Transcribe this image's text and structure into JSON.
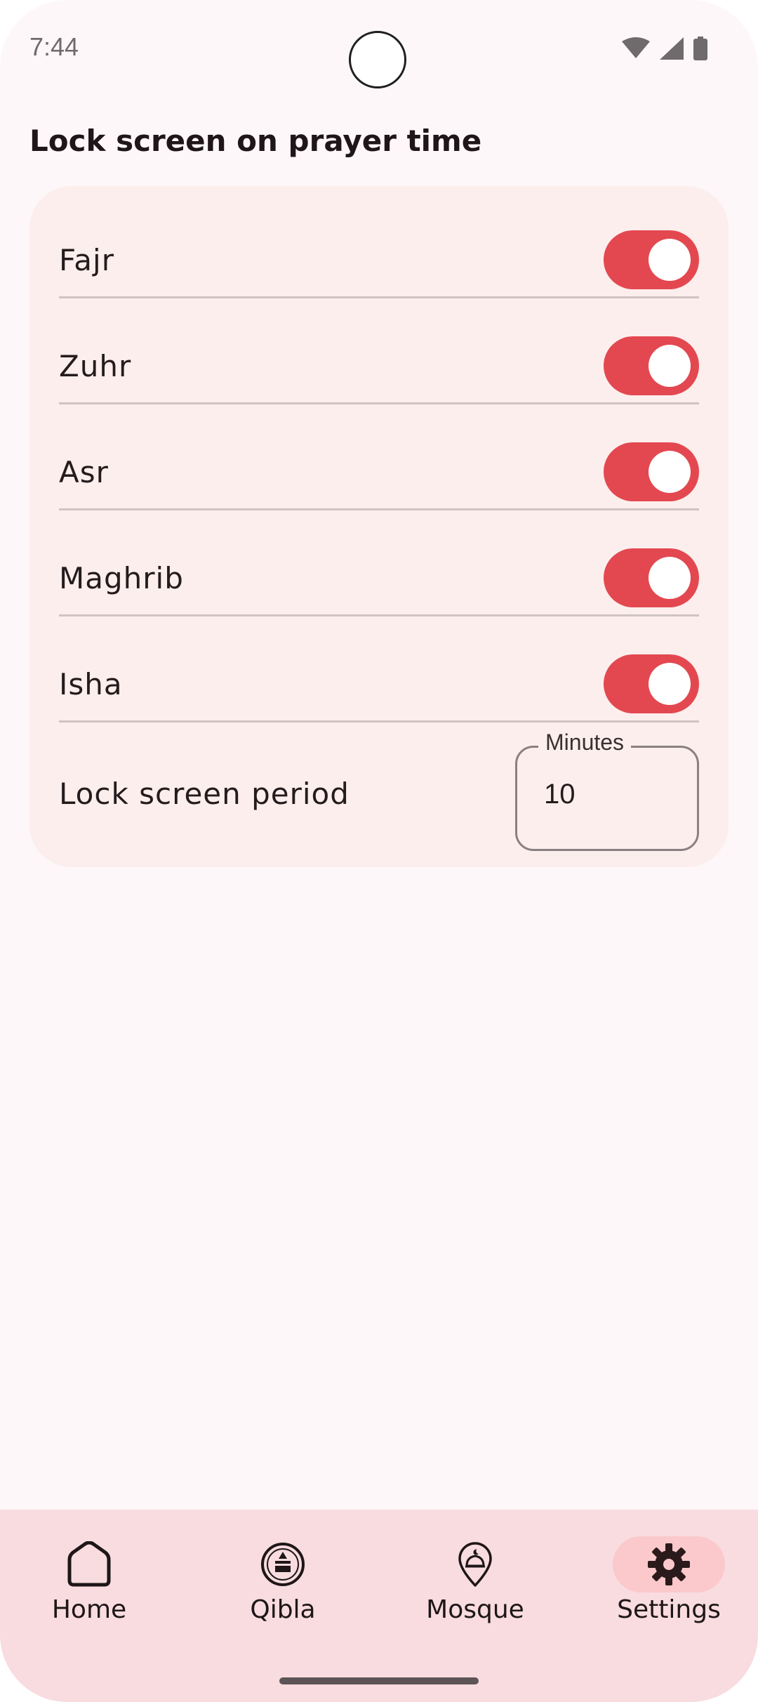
{
  "status_bar": {
    "time": "7:44"
  },
  "header": {
    "title": "Lock screen on prayer time"
  },
  "prayers": [
    {
      "label": "Fajr",
      "enabled": true
    },
    {
      "label": "Zuhr",
      "enabled": true
    },
    {
      "label": "Asr",
      "enabled": true
    },
    {
      "label": "Maghrib",
      "enabled": true
    },
    {
      "label": "Isha",
      "enabled": true
    }
  ],
  "lock_period": {
    "label": "Lock screen period",
    "field_label": "Minutes",
    "value": "10"
  },
  "bottom_nav": {
    "items": [
      {
        "label": "Home",
        "icon": "home-icon"
      },
      {
        "label": "Qibla",
        "icon": "qibla-icon"
      },
      {
        "label": "Mosque",
        "icon": "mosque-icon"
      },
      {
        "label": "Settings",
        "icon": "gear-icon",
        "active": true
      }
    ]
  },
  "colors": {
    "accent": "#e34850",
    "card": "#fceeed",
    "nav_bg": "#f8dcdf",
    "active_pill": "#fbc9cb"
  }
}
